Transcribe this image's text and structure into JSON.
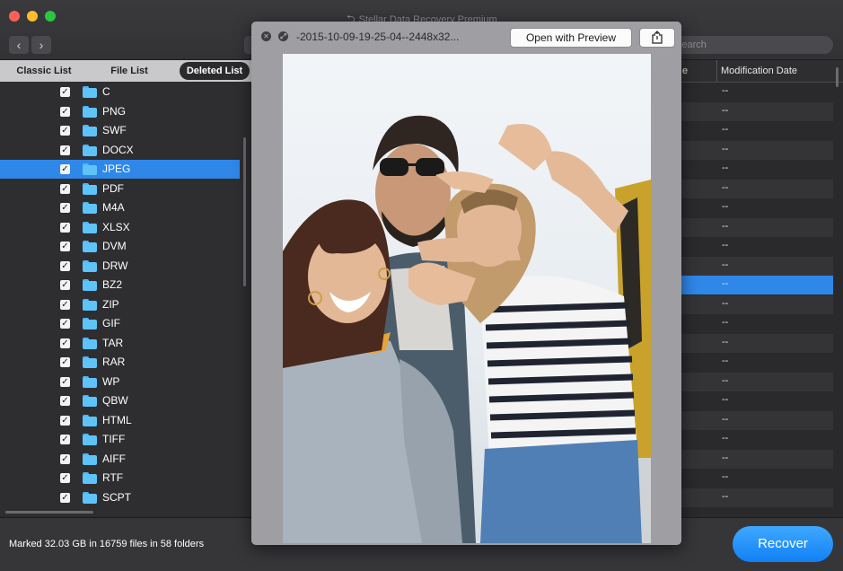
{
  "window": {
    "title": "Stellar Data Recovery Premium",
    "search_placeholder": "Search"
  },
  "tabs": [
    {
      "label": "Classic List",
      "selected": false
    },
    {
      "label": "File List",
      "selected": false
    },
    {
      "label": "Deleted List",
      "selected": true
    }
  ],
  "sidebar": {
    "items": [
      {
        "label": "C",
        "checked": true,
        "selected": false
      },
      {
        "label": "PNG",
        "checked": true,
        "selected": false
      },
      {
        "label": "SWF",
        "checked": true,
        "selected": false
      },
      {
        "label": "DOCX",
        "checked": true,
        "selected": false
      },
      {
        "label": "JPEG",
        "checked": true,
        "selected": true
      },
      {
        "label": "PDF",
        "checked": true,
        "selected": false
      },
      {
        "label": "M4A",
        "checked": true,
        "selected": false
      },
      {
        "label": "XLSX",
        "checked": true,
        "selected": false
      },
      {
        "label": "DVM",
        "checked": true,
        "selected": false
      },
      {
        "label": "DRW",
        "checked": true,
        "selected": false
      },
      {
        "label": "BZ2",
        "checked": true,
        "selected": false
      },
      {
        "label": "ZIP",
        "checked": true,
        "selected": false
      },
      {
        "label": "GIF",
        "checked": true,
        "selected": false
      },
      {
        "label": "TAR",
        "checked": true,
        "selected": false
      },
      {
        "label": "RAR",
        "checked": true,
        "selected": false
      },
      {
        "label": "WP",
        "checked": true,
        "selected": false
      },
      {
        "label": "QBW",
        "checked": true,
        "selected": false
      },
      {
        "label": "HTML",
        "checked": true,
        "selected": false
      },
      {
        "label": "TIFF",
        "checked": true,
        "selected": false
      },
      {
        "label": "AIFF",
        "checked": true,
        "selected": false
      },
      {
        "label": "RTF",
        "checked": true,
        "selected": false
      },
      {
        "label": "SCPT",
        "checked": true,
        "selected": false
      }
    ],
    "check_glyph": "✓"
  },
  "table": {
    "columns": [
      "e",
      "Modification Date"
    ],
    "rows": [
      "--",
      "--",
      "--",
      "--",
      "--",
      "--",
      "--",
      "--",
      "--",
      "--",
      "--",
      "--",
      "--",
      "--",
      "--",
      "--",
      "--",
      "--",
      "--",
      "--",
      "--",
      "--"
    ],
    "selected_row_index": 10
  },
  "quicklook": {
    "filename": "-2015-10-09-19-25-04--2448x32...",
    "open_button": "Open with Preview"
  },
  "status": {
    "text": "Marked 32.03 GB in 16759 files in 58 folders"
  },
  "recover_button": "Recover",
  "colors": {
    "accent": "#2f87e8",
    "folder": "#5ec3f8",
    "recover_button": "#1f8ff8"
  },
  "icons": {
    "back": "chevron-left-icon",
    "forward": "chevron-right-icon",
    "close": "close-icon",
    "fullscreen": "fullscreen-icon",
    "share": "share-icon",
    "folder": "folder-icon",
    "checkbox": "checkbox-checked-icon"
  }
}
